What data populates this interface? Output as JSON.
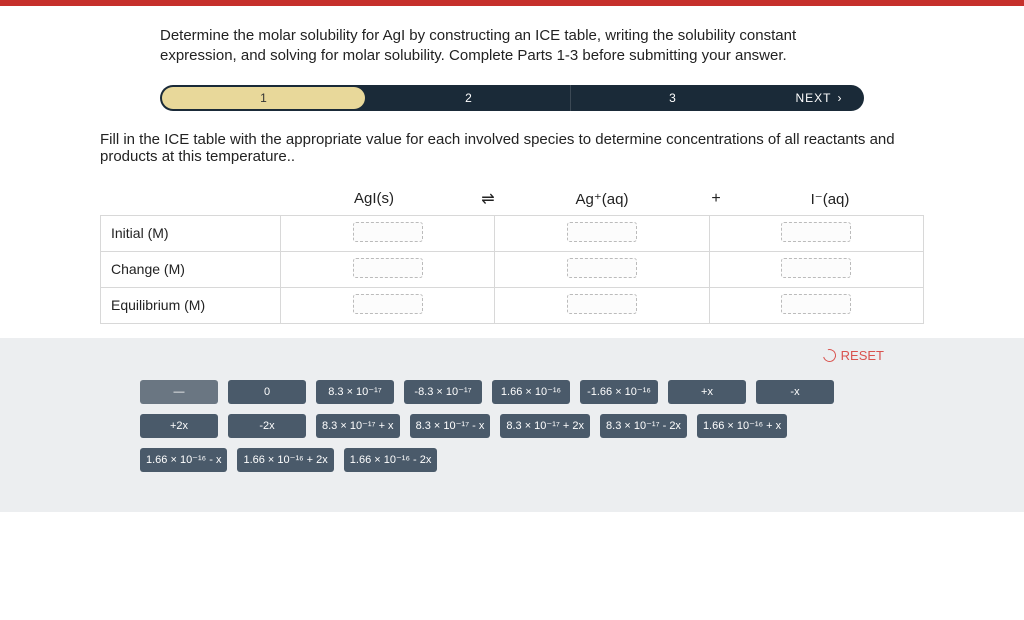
{
  "question": "Determine the molar solubility for AgI by constructing an ICE table, writing the solubility constant expression, and solving for molar solubility. Complete Parts 1-3 before submitting your answer.",
  "stepper": {
    "steps": [
      "1",
      "2",
      "3"
    ],
    "active": 0,
    "next": "NEXT"
  },
  "instruction": "Fill in the ICE table with the appropriate value for each involved species to determine concentrations of all reactants and products at this temperature..",
  "equation": {
    "s1": "AgI(s)",
    "sym": "⇌",
    "s2": "Ag⁺(aq)",
    "plus": "+",
    "s3": "I⁻(aq)"
  },
  "rows": {
    "initial": "Initial (M)",
    "change": "Change (M)",
    "equil": "Equilibrium (M)"
  },
  "reset": "RESET",
  "tiles": [
    "—",
    "0",
    "8.3 × 10⁻¹⁷",
    "-8.3 × 10⁻¹⁷",
    "1.66 × 10⁻¹⁶",
    "-1.66 × 10⁻¹⁶",
    "+x",
    "-x",
    "+2x",
    "-2x",
    "8.3 × 10⁻¹⁷ + x",
    "8.3 × 10⁻¹⁷ - x",
    "8.3 × 10⁻¹⁷ + 2x",
    "8.3 × 10⁻¹⁷ - 2x",
    "1.66 × 10⁻¹⁶ + x",
    "1.66 × 10⁻¹⁶ - x",
    "1.66 × 10⁻¹⁶ + 2x",
    "1.66 × 10⁻¹⁶ - 2x"
  ]
}
